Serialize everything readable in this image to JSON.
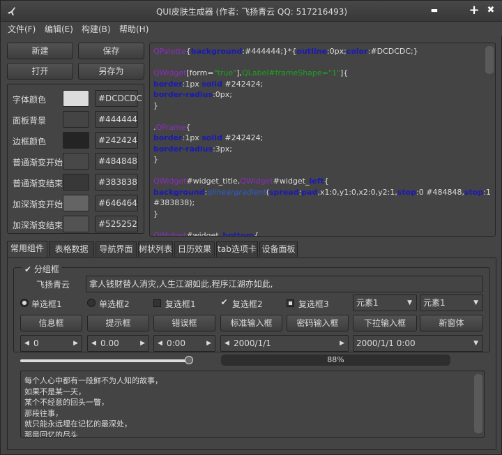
{
  "window": {
    "title": "QUI皮肤生成器 (作者: 飞扬青云  QQ: 517216493)",
    "minimize": "▬",
    "maximize": "+",
    "close": "✖"
  },
  "menu": [
    "文件(F)",
    "编辑(E)",
    "构建(B)",
    "帮助(H)"
  ],
  "buttons": {
    "new": "新建",
    "save": "保存",
    "open": "打开",
    "save_as": "另存为"
  },
  "colors": {
    "rows": [
      {
        "label": "字体颜色",
        "value": "#DCDCDC"
      },
      {
        "label": "面板背景",
        "value": "#444444"
      },
      {
        "label": "边框颜色",
        "value": "#242424"
      },
      {
        "label": "普通渐变开始",
        "value": "#484848"
      },
      {
        "label": "普通渐变结束",
        "value": "#383838"
      },
      {
        "label": "加深渐变开始",
        "value": "#646464"
      },
      {
        "label": "加深渐变结束",
        "value": "#525252"
      }
    ]
  },
  "code": {
    "l1a": "QPalette",
    "l1b": "{",
    "l1c": "background",
    "l1d": ":#444444;}*{",
    "l1e": "outline",
    "l1f": ":0px;",
    "l1g": "color",
    "l1h": ":#DCDCDC;}",
    "l3a": "QWidget",
    "l3b": "[form=",
    "l3c": "\"true\"",
    "l3d": "],",
    "l3e": "QLabel#frameShape=\"1\"",
    "l3f": "]{",
    "l4a": "border",
    "l4b": ":1px ",
    "l4c": "solid",
    "l4d": " #242424;",
    "l5a": "border-radius",
    "l5b": ":0px;",
    "l6": "}",
    "l8a": ".",
    "l8b": "QFrame",
    "l8c": "{",
    "l9a": "border",
    "l9b": ":1px ",
    "l9c": "solid",
    "l9d": " #242424;",
    "l10a": "border-radius",
    "l10b": ":3px;",
    "l11": "}",
    "l13a": "QWidget",
    "l13b": "#widget_title,",
    "l13c": "QWidget",
    "l13d": "#widget_",
    "l13e": "left",
    "l13f": "{",
    "l14a": "background",
    "l14b": ":",
    "l14c": "qlineargradient",
    "l14d": "(",
    "l14e": "spread",
    "l14f": ":",
    "l14g": "pad",
    ",l14h": "",
    "l14h": ",x1:0,y1:0,x2:0,y2:1,",
    "l14i": "stop",
    "l14j": ":0 #484848,",
    "l14k": "stop",
    "l14l": ":1",
    "l15": "#383838);",
    "l16": "}",
    "l18a": "QWidget",
    "l18b": "#widget_",
    "l18c": "bottom",
    "l18d": "{"
  },
  "tabs": [
    "常用组件",
    "表格数据",
    "导航界面",
    "树状列表",
    "日历效果",
    "tab选项卡",
    "设备面板"
  ],
  "group": {
    "title": "分组框",
    "name_label": "飞扬青云",
    "name_value": "拿人钱财替人消灾,人生江湖如此,程序江湖亦如此,"
  },
  "radios": [
    {
      "label": "单选框1",
      "checked": true
    },
    {
      "label": "单选框2",
      "checked": false
    }
  ],
  "checks": [
    {
      "label": "复选框1",
      "checked": false
    },
    {
      "label": "复选框2",
      "checked": true
    },
    {
      "label": "复选框3",
      "checked": "partial"
    }
  ],
  "combos": {
    "c1": "元素1",
    "c2": "元素1"
  },
  "actions": [
    "信息框",
    "提示框",
    "错误框",
    "标准输入框",
    "密码输入框",
    "下拉输入框",
    "新窗体"
  ],
  "spins": {
    "int": "0",
    "double": "0.00",
    "time": "0:00",
    "date": "2000/1/1",
    "datetime": "2000/1/1 0:00"
  },
  "slider": {
    "value": 0.99
  },
  "progress": {
    "value": 88,
    "text": "88%"
  },
  "poem": [
    "每个人心中都有一段鲜不为人知的故事，",
    "如果不是某一天，",
    "某个不经意的回头一瞥，",
    "那段往事，",
    "就只能永远埋在记忆的最深处，",
    "那是回忆的尽头"
  ]
}
